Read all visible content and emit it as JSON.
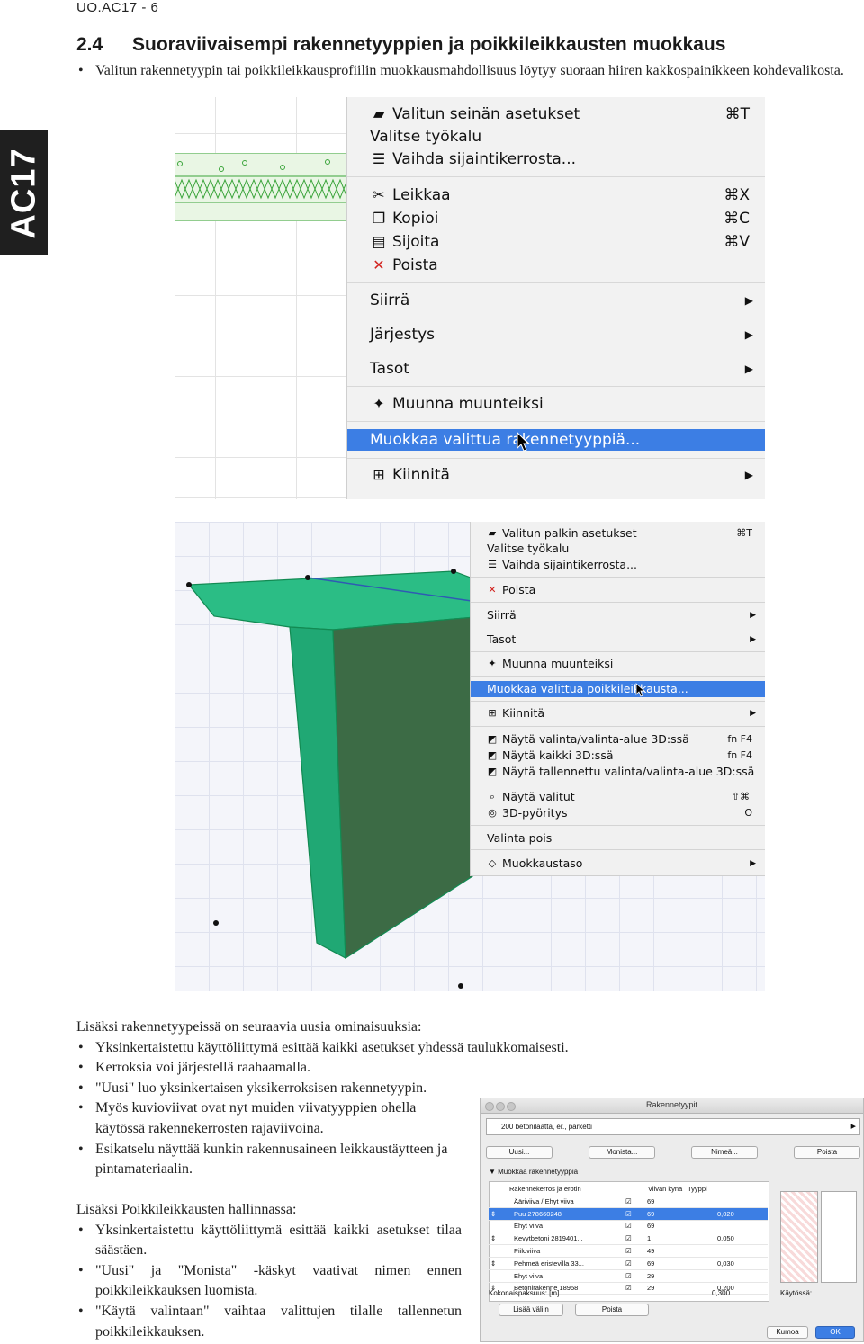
{
  "header": {
    "code": "UO.AC17 - 6"
  },
  "side_tab": {
    "label": "AC17"
  },
  "section": {
    "number": "2.4",
    "title": "Suoraviivaisempi rakennetyyppien ja poikkileikkausten muokkaus",
    "intro_bullet": "Valitun rakennetyypin tai poikkileikkausprofiilin muokkausmahdollisuus löytyy suoraan hiiren kakkospainikkeen kohdevalikosta."
  },
  "menu1": {
    "items": [
      {
        "label": "Valitun seinän asetukset",
        "shortcut": "⌘T",
        "icon": "wall-settings-icon"
      },
      {
        "label": "Valitse työkalu",
        "shortcut": "",
        "icon": ""
      },
      {
        "label": "Vaihda sijaintikerrosta...",
        "shortcut": "",
        "icon": "story-icon"
      },
      {
        "label": "Leikkaa",
        "shortcut": "⌘X",
        "icon": "scissors-icon"
      },
      {
        "label": "Kopioi",
        "shortcut": "⌘C",
        "icon": "copy-icon"
      },
      {
        "label": "Sijoita",
        "shortcut": "⌘V",
        "icon": "paste-icon"
      },
      {
        "label": "Poista",
        "shortcut": "",
        "icon": "delete-icon"
      },
      {
        "label": "Siirrä",
        "submenu": true
      },
      {
        "label": "Järjestys",
        "submenu": true
      },
      {
        "label": "Tasot",
        "submenu": true
      },
      {
        "label": "Muunna muunteiksi",
        "icon": "transform-icon"
      },
      {
        "label": "Muokkaa valittua rakennetyyppiä...",
        "highlighted": true
      },
      {
        "label": "Kiinnitä",
        "submenu": true,
        "icon": "pin-icon"
      }
    ]
  },
  "menu2": {
    "items": [
      {
        "label": "Valitun palkin asetukset",
        "shortcut": "⌘T"
      },
      {
        "label": "Valitse työkalu"
      },
      {
        "label": "Vaihda sijaintikerrosta..."
      },
      {
        "label": "Poista"
      },
      {
        "label": "Siirrä",
        "submenu": true
      },
      {
        "label": "Tasot",
        "submenu": true
      },
      {
        "label": "Muunna muunteiksi"
      },
      {
        "label": "Muokkaa valittua poikkileikkausta...",
        "highlighted": true
      },
      {
        "label": "Kiinnitä",
        "submenu": true
      },
      {
        "label": "Näytä valinta/valinta-alue 3D:ssä",
        "shortcut": "fn F4"
      },
      {
        "label": "Näytä kaikki 3D:ssä",
        "shortcut": "fn F4"
      },
      {
        "label": "Näytä tallennettu valinta/valinta-alue 3D:ssä"
      },
      {
        "label": "Näytä valitut",
        "shortcut": "⇧⌘'"
      },
      {
        "label": "3D-pyöritys",
        "shortcut": "O"
      },
      {
        "label": "Valinta pois"
      },
      {
        "label": "Muokkaustaso",
        "submenu": true
      }
    ]
  },
  "body1": {
    "lead": "Lisäksi rakennetyypeissä on seuraavia uusia ominaisuuksia:",
    "bullets": [
      "Yksinkertaistettu käyttöliittymä esittää kaikki asetukset yhdessä taulukkomaisesti.",
      "Kerroksia voi järjestellä raahaamalla.",
      "\"Uusi\" luo yksinkertaisen yksikerroksisen rakennetyypin.",
      "Myös kuvioviivat ovat nyt muiden viivatyyppien ohella käytössä rakennekerrosten rajaviivoina.",
      "Esikatselu näyttää kunkin rakennusaineen leikkaustäytteen ja pintamateriaalin."
    ]
  },
  "body2": {
    "lead": "Lisäksi Poikkileikkausten hallinnassa:",
    "bullets": [
      "Yksinkertaistettu käyttöliittymä esittää kaikki asetukset tilaa säästäen.",
      "\"Uusi\" ja \"Monista\" -käskyt vaativat nimen ennen poikkileikkauksen luomista.",
      "\"Käytä valintaan\" vaihtaa valittujen tilalle tallennetun poikkileikkauksen."
    ]
  },
  "dialog": {
    "title": "Rakennetyypit",
    "selected_type": "200 betonilaatta, er., parketti",
    "buttons": {
      "new": "Uusi...",
      "duplicate": "Monista...",
      "rename": "Nimeä...",
      "delete": "Poista"
    },
    "section_label": "Muokkaa rakennetyyppiä",
    "columns": [
      "Rakennekerros ja erotin",
      "Viivan kynä",
      "Tyyppi"
    ],
    "rows": [
      {
        "name": "Ääriviiva / Ehyt viiva",
        "pen": "69",
        "thickness": ""
      },
      {
        "name": "Puu 278660248",
        "pen": "69",
        "thickness": "0,020",
        "highlighted": true
      },
      {
        "name": "Ehyt viiva",
        "pen": "69",
        "thickness": ""
      },
      {
        "name": "Kevytbetoni 2819401...",
        "pen": "1",
        "thickness": "0,050"
      },
      {
        "name": "Piiloviiva",
        "pen": "49",
        "thickness": ""
      },
      {
        "name": "Pehmeä eristevilla 33...",
        "pen": "69",
        "thickness": "0,030"
      },
      {
        "name": "Ehyt viiva",
        "pen": "29",
        "thickness": ""
      },
      {
        "name": "Betonirakenne 18958",
        "pen": "29",
        "thickness": "0,200"
      }
    ],
    "total_label": "Kokonaispaksuus: [m]",
    "total_value": "0,300",
    "usage_label": "Käytössä:",
    "insert_below": "Lisää väliin",
    "remove": "Poista",
    "cancel": "Kumoa",
    "ok": "OK"
  },
  "colors": {
    "highlight": "#3c7ee4",
    "beam_green": "#1fa877",
    "side_tab": "#1f1f1f"
  }
}
